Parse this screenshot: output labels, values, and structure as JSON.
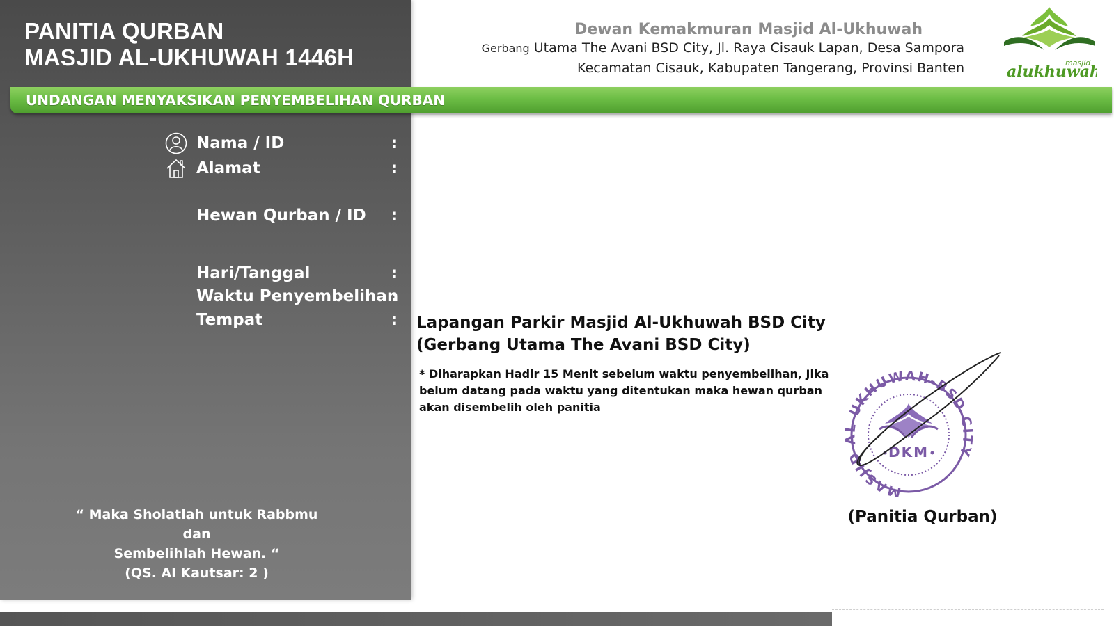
{
  "header": {
    "title_line1": "PANITIA QURBAN",
    "title_line2": "MASJID AL-UKHUWAH 1446H",
    "org_name": "Dewan Kemakmuran Masjid Al-Ukhuwah",
    "address_prefix": "Gerbang",
    "address_line1": " Utama The Avani BSD City, Jl. Raya Cisauk Lapan, Desa Sampora",
    "address_line2": "Kecamatan Cisauk, Kabupaten Tangerang, Provinsi Banten",
    "logo_small_text": "masjid",
    "logo_text": "alukhuwah"
  },
  "banner": {
    "label": "UNDANGAN MENYAKSIKAN PENYEMBELIHAN QURBAN"
  },
  "fields": {
    "name": "Nama / ID",
    "address": "Alamat",
    "animal": "Hewan Qurban / ID",
    "date": "Hari/Tanggal",
    "time": "Waktu Penyembelihan",
    "place": "Tempat",
    "separator": ":"
  },
  "place_info": {
    "line1": "Lapangan Parkir Masjid Al-Ukhuwah BSD City",
    "line2": "(Gerbang Utama The Avani BSD City)"
  },
  "note": "* Diharapkan Hadir 15 Menit sebelum waktu penyembelihan, Jika belum datang pada waktu yang ditentukan maka hewan qurban akan disembelih oleh panitia",
  "quote": {
    "line1": "“ Maka Sholatlah untuk Rabbmu dan",
    "line2": "Sembelihlah Hewan. “",
    "source": "(QS. Al Kautsar: 2 )"
  },
  "stamp": {
    "ring_text": "MASJID AL UKHUWAH-BSD CITY",
    "center_text": "DKM"
  },
  "signature": {
    "label": "(Panitia Qurban)"
  },
  "icons": {
    "user": "user-circle-icon",
    "home": "home-icon"
  },
  "colors": {
    "banner_green": "#6cbd45",
    "stamp_purple": "#7b5aa6",
    "logo_green": "#5aa02c"
  }
}
